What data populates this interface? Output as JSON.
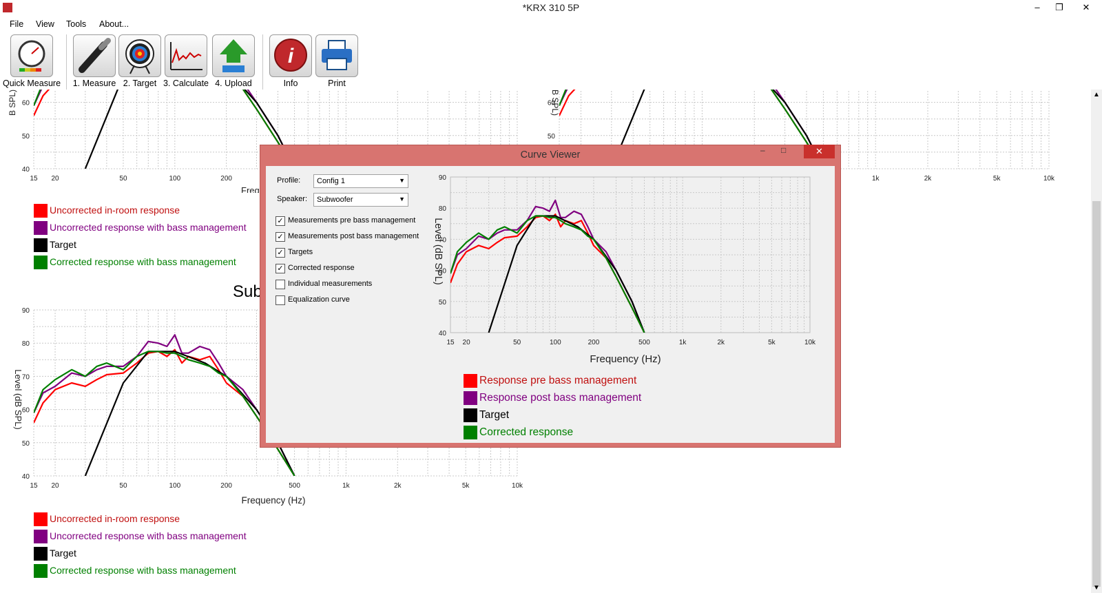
{
  "window": {
    "title": "*KRX 310 5P",
    "minimize": "–",
    "restore": "❐",
    "close": "✕"
  },
  "menu": [
    "File",
    "View",
    "Tools",
    "About..."
  ],
  "toolbar": [
    {
      "label": "Quick Measure",
      "icon": "gauge-icon"
    },
    {
      "label": "1. Measure",
      "icon": "microphone-icon"
    },
    {
      "label": "2. Target",
      "icon": "target-icon"
    },
    {
      "label": "3. Calculate",
      "icon": "graph-icon"
    },
    {
      "label": "4. Upload",
      "icon": "upload-icon"
    },
    {
      "label": "Info",
      "icon": "info-icon"
    },
    {
      "label": "Print",
      "icon": "printer-icon"
    }
  ],
  "background": {
    "section_title": "Sub",
    "x_axis_label": "Frequency (Hz)",
    "x_axis_label_partial": "Freq",
    "y_axis_label": "Level (dB SPL)",
    "y_axis_label_partial": "B SPL)",
    "legend": [
      {
        "label": "Uncorrected in-room response",
        "color": "#ff0000"
      },
      {
        "label": "Uncorrected response with bass management",
        "color": "#800080"
      },
      {
        "label": "Target",
        "color": "#000000"
      },
      {
        "label": "Corrected response with bass management",
        "color": "#008000"
      }
    ]
  },
  "dialog": {
    "title": "Curve Viewer",
    "profile_label": "Profile:",
    "profile_value": "Config 1",
    "speaker_label": "Speaker:",
    "speaker_value": "Subwoofer",
    "checkboxes": [
      {
        "label": "Measurements pre bass management",
        "checked": true
      },
      {
        "label": "Measurements post bass management",
        "checked": true
      },
      {
        "label": "Targets",
        "checked": true
      },
      {
        "label": "Corrected response",
        "checked": true
      },
      {
        "label": "Individual measurements",
        "checked": false
      },
      {
        "label": "Equalization curve",
        "checked": false
      }
    ],
    "legend": [
      {
        "label": "Response pre bass management",
        "color": "#ff0000"
      },
      {
        "label": "Response post bass management",
        "color": "#800080"
      },
      {
        "label": "Target",
        "color": "#000000"
      },
      {
        "label": "Corrected response",
        "color": "#008000"
      }
    ]
  },
  "chart_data": {
    "type": "line",
    "xlabel": "Frequency (Hz)",
    "ylabel": "Level (dB SPL)",
    "x_scale": "log",
    "xlim": [
      15,
      10000
    ],
    "ylim": [
      40,
      90
    ],
    "x_ticks": [
      15,
      20,
      50,
      100,
      200,
      500,
      1000,
      2000,
      5000,
      10000
    ],
    "x_tick_labels": [
      "15",
      "20",
      "50",
      "100",
      "200",
      "500",
      "1k",
      "2k",
      "5k",
      "10k"
    ],
    "y_ticks": [
      40,
      50,
      60,
      70,
      80,
      90
    ],
    "grid": true,
    "series": [
      {
        "name": "Response pre bass management",
        "color": "#ff0000",
        "x": [
          15,
          17,
          20,
          25,
          30,
          35,
          40,
          50,
          60,
          70,
          80,
          90,
          100,
          110,
          120,
          140,
          160,
          180,
          200,
          250,
          300,
          400,
          500
        ],
        "y": [
          56,
          62,
          66,
          68,
          67,
          69,
          70.5,
          71,
          74,
          77,
          77.5,
          76,
          78,
          74,
          76,
          75,
          76,
          72,
          68,
          64,
          58,
          48,
          40
        ]
      },
      {
        "name": "Response post bass management",
        "color": "#800080",
        "x": [
          15,
          17,
          20,
          25,
          30,
          35,
          40,
          50,
          60,
          70,
          80,
          90,
          100,
          110,
          120,
          140,
          160,
          180,
          200,
          250,
          300,
          400,
          500
        ],
        "y": [
          59,
          65,
          67,
          71,
          70,
          72,
          73,
          73,
          76,
          80.5,
          80,
          79,
          82.5,
          77,
          77,
          79,
          78,
          74,
          70,
          66,
          60,
          50,
          40
        ]
      },
      {
        "name": "Target",
        "color": "#000000",
        "x": [
          30,
          50,
          70,
          100,
          150,
          200,
          300,
          400,
          500
        ],
        "y": [
          40,
          68,
          77.5,
          77.5,
          74,
          70,
          60,
          50,
          40
        ]
      },
      {
        "name": "Corrected response",
        "color": "#008000",
        "x": [
          15,
          17,
          20,
          25,
          30,
          35,
          40,
          50,
          60,
          70,
          80,
          90,
          100,
          110,
          120,
          140,
          160,
          180,
          200,
          250,
          300,
          400,
          500
        ],
        "y": [
          59,
          66,
          69,
          72,
          70,
          73,
          74,
          72,
          76,
          77.5,
          77.5,
          77,
          77,
          76,
          75,
          74,
          73,
          71,
          70,
          64,
          58,
          48,
          40
        ]
      }
    ]
  }
}
